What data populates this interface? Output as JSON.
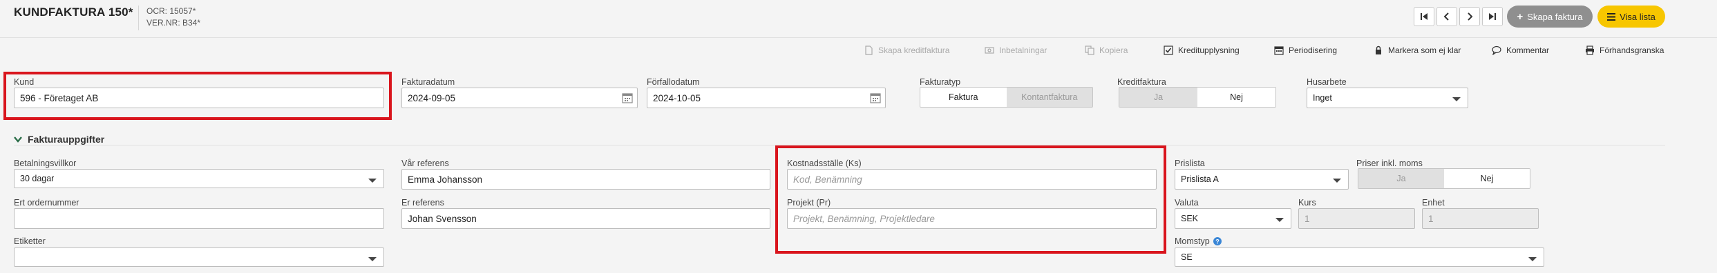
{
  "header": {
    "title": "KUNDFAKTURA 150*",
    "ocr": "OCR: 15057*",
    "vernr": "VER.NR: B34*",
    "create_invoice": "Skapa faktura",
    "show_list": "Visa lista"
  },
  "toolbar": {
    "credit_invoice": "Skapa kreditfaktura",
    "payments": "Inbetalningar",
    "copy": "Kopiera",
    "credit_info": "Kreditupplysning",
    "periodization": "Periodisering",
    "mark_ready": "Markera som ej klar",
    "comment": "Kommentar",
    "preview": "Förhandsgranska"
  },
  "form": {
    "customer": {
      "label": "Kund",
      "value": "596 - Företaget AB"
    },
    "invoice_date": {
      "label": "Fakturadatum",
      "value": "2024-09-05"
    },
    "due_date": {
      "label": "Förfallodatum",
      "value": "2024-10-05"
    },
    "invoice_type": {
      "label": "Fakturatyp",
      "option_a": "Faktura",
      "option_b": "Kontantfaktura"
    },
    "credit_invoice": {
      "label": "Kreditfaktura",
      "yes": "Ja",
      "no": "Nej"
    },
    "house_work": {
      "label": "Husarbete",
      "value": "Inget"
    }
  },
  "section": {
    "title": "Fakturauppgifter"
  },
  "details": {
    "payment_terms": {
      "label": "Betalningsvillkor",
      "value": "30 dagar"
    },
    "your_order_no": {
      "label": "Ert ordernummer",
      "value": ""
    },
    "tags": {
      "label": "Etiketter",
      "value": ""
    },
    "our_reference": {
      "label": "Vår referens",
      "value": "Emma Johansson"
    },
    "your_reference": {
      "label": "Er referens",
      "value": "Johan Svensson"
    },
    "cost_center": {
      "label": "Kostnadsställe (Ks)",
      "placeholder": "Kod, Benämning"
    },
    "project": {
      "label": "Projekt (Pr)",
      "placeholder": "Projekt, Benämning, Projektledare"
    },
    "price_list": {
      "label": "Prislista",
      "value": "Prislista A"
    },
    "prices_incl_vat": {
      "label": "Priser inkl. moms",
      "yes": "Ja",
      "no": "Nej"
    },
    "currency": {
      "label": "Valuta",
      "value": "SEK"
    },
    "rate": {
      "label": "Kurs",
      "value": "1"
    },
    "unit": {
      "label": "Enhet",
      "value": "1"
    },
    "vat_type": {
      "label": "Momstyp",
      "value": "SE"
    }
  },
  "colors": {
    "accent_yellow": "#f7c600",
    "highlight_red": "#d9151d",
    "help_blue": "#3a86d6"
  }
}
